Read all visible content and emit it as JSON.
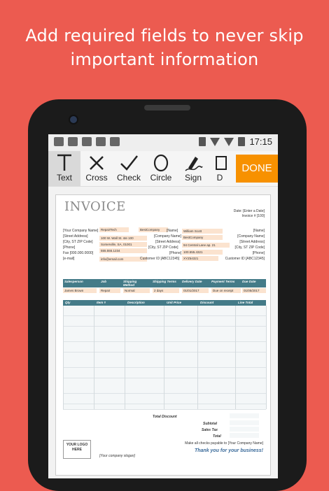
{
  "headline": {
    "line1": "Add required fields to never skip",
    "line2": "important information"
  },
  "statusbar": {
    "time": "17:15"
  },
  "toolbar": {
    "tools": [
      {
        "label": "Text",
        "icon": "text-icon"
      },
      {
        "label": "Cross",
        "icon": "cross-icon"
      },
      {
        "label": "Check",
        "icon": "check-icon"
      },
      {
        "label": "Circle",
        "icon": "circle-icon"
      },
      {
        "label": "Sign",
        "icon": "sign-icon"
      },
      {
        "label": "D",
        "icon": "date-icon"
      }
    ],
    "done_label": "DONE"
  },
  "invoice": {
    "title": "INVOICE",
    "date": "Date: [Enter a Date]",
    "invoice_no": "Invoice # [100]",
    "left_labels": [
      "[Your Company Name]",
      "[Street Address]",
      "[City, ST  ZIP Code]",
      "[Phone]",
      "Fax [000.000.0000]",
      "[e-mail]"
    ],
    "left_fields": [
      "RepairTech",
      "100 W. Wall St. ste 100",
      "Somerville, SA, 01001",
      "555.555.1234",
      "info@email.com"
    ],
    "mid_field": "BestCompany",
    "mid_labels": [
      "[Name]",
      "[Company Name]",
      "[Street Address]",
      "[City, ST  ZIP Code]",
      "[Phone]",
      "Customer ID [ABC12345]"
    ],
    "ship_fields": [
      "William Scott",
      "BestCompany",
      "94 Central Lane ap. 21",
      "100.555.4321",
      "XYZ54321"
    ],
    "ship_labels": [
      "[Name]",
      "[Company Name]",
      "[Street Address]",
      "[City, ST  ZIP Code]",
      "[Phone]",
      "Customer ID [ABC12345]"
    ],
    "order_headers": [
      "Salesperson",
      "Job",
      "Shipping Method",
      "Shipping Terms",
      "Delivery Date",
      "Payment Terms",
      "Due Date"
    ],
    "order_values": [
      "James Brown",
      "Repair",
      "Normal",
      "2 days",
      "01/01/2017",
      "Due on receipt",
      "01/05/2017"
    ],
    "item_headers": [
      "Qty",
      "Item #",
      "Description",
      "Unit Price",
      "Discount",
      "Line Total"
    ],
    "total_discount": "Total Discount",
    "subtotal": "Subtotal",
    "sales_tax": "Sales Tax",
    "total": "Total",
    "logo": "YOUR LOGO HERE",
    "slogan": "[Your company slogan]",
    "checks_note": "Make all checks payable to [Your Company Name]",
    "thanks": "Thank you for your business!"
  }
}
